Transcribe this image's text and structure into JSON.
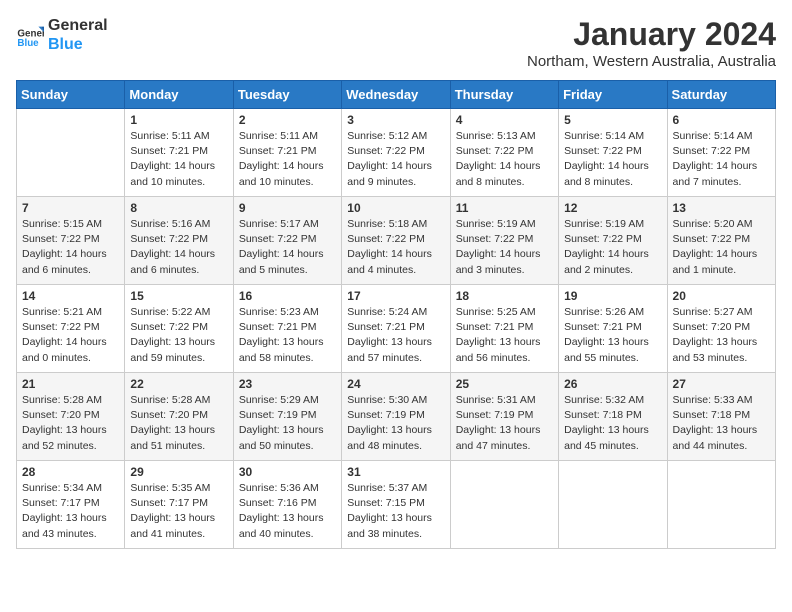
{
  "header": {
    "logo_line1": "General",
    "logo_line2": "Blue",
    "month_title": "January 2024",
    "location": "Northam, Western Australia, Australia"
  },
  "weekdays": [
    "Sunday",
    "Monday",
    "Tuesday",
    "Wednesday",
    "Thursday",
    "Friday",
    "Saturday"
  ],
  "weeks": [
    [
      {
        "day": "",
        "info": ""
      },
      {
        "day": "1",
        "info": "Sunrise: 5:11 AM\nSunset: 7:21 PM\nDaylight: 14 hours\nand 10 minutes."
      },
      {
        "day": "2",
        "info": "Sunrise: 5:11 AM\nSunset: 7:21 PM\nDaylight: 14 hours\nand 10 minutes."
      },
      {
        "day": "3",
        "info": "Sunrise: 5:12 AM\nSunset: 7:22 PM\nDaylight: 14 hours\nand 9 minutes."
      },
      {
        "day": "4",
        "info": "Sunrise: 5:13 AM\nSunset: 7:22 PM\nDaylight: 14 hours\nand 8 minutes."
      },
      {
        "day": "5",
        "info": "Sunrise: 5:14 AM\nSunset: 7:22 PM\nDaylight: 14 hours\nand 8 minutes."
      },
      {
        "day": "6",
        "info": "Sunrise: 5:14 AM\nSunset: 7:22 PM\nDaylight: 14 hours\nand 7 minutes."
      }
    ],
    [
      {
        "day": "7",
        "info": "Sunrise: 5:15 AM\nSunset: 7:22 PM\nDaylight: 14 hours\nand 6 minutes."
      },
      {
        "day": "8",
        "info": "Sunrise: 5:16 AM\nSunset: 7:22 PM\nDaylight: 14 hours\nand 6 minutes."
      },
      {
        "day": "9",
        "info": "Sunrise: 5:17 AM\nSunset: 7:22 PM\nDaylight: 14 hours\nand 5 minutes."
      },
      {
        "day": "10",
        "info": "Sunrise: 5:18 AM\nSunset: 7:22 PM\nDaylight: 14 hours\nand 4 minutes."
      },
      {
        "day": "11",
        "info": "Sunrise: 5:19 AM\nSunset: 7:22 PM\nDaylight: 14 hours\nand 3 minutes."
      },
      {
        "day": "12",
        "info": "Sunrise: 5:19 AM\nSunset: 7:22 PM\nDaylight: 14 hours\nand 2 minutes."
      },
      {
        "day": "13",
        "info": "Sunrise: 5:20 AM\nSunset: 7:22 PM\nDaylight: 14 hours\nand 1 minute."
      }
    ],
    [
      {
        "day": "14",
        "info": "Sunrise: 5:21 AM\nSunset: 7:22 PM\nDaylight: 14 hours\nand 0 minutes."
      },
      {
        "day": "15",
        "info": "Sunrise: 5:22 AM\nSunset: 7:22 PM\nDaylight: 13 hours\nand 59 minutes."
      },
      {
        "day": "16",
        "info": "Sunrise: 5:23 AM\nSunset: 7:21 PM\nDaylight: 13 hours\nand 58 minutes."
      },
      {
        "day": "17",
        "info": "Sunrise: 5:24 AM\nSunset: 7:21 PM\nDaylight: 13 hours\nand 57 minutes."
      },
      {
        "day": "18",
        "info": "Sunrise: 5:25 AM\nSunset: 7:21 PM\nDaylight: 13 hours\nand 56 minutes."
      },
      {
        "day": "19",
        "info": "Sunrise: 5:26 AM\nSunset: 7:21 PM\nDaylight: 13 hours\nand 55 minutes."
      },
      {
        "day": "20",
        "info": "Sunrise: 5:27 AM\nSunset: 7:20 PM\nDaylight: 13 hours\nand 53 minutes."
      }
    ],
    [
      {
        "day": "21",
        "info": "Sunrise: 5:28 AM\nSunset: 7:20 PM\nDaylight: 13 hours\nand 52 minutes."
      },
      {
        "day": "22",
        "info": "Sunrise: 5:28 AM\nSunset: 7:20 PM\nDaylight: 13 hours\nand 51 minutes."
      },
      {
        "day": "23",
        "info": "Sunrise: 5:29 AM\nSunset: 7:19 PM\nDaylight: 13 hours\nand 50 minutes."
      },
      {
        "day": "24",
        "info": "Sunrise: 5:30 AM\nSunset: 7:19 PM\nDaylight: 13 hours\nand 48 minutes."
      },
      {
        "day": "25",
        "info": "Sunrise: 5:31 AM\nSunset: 7:19 PM\nDaylight: 13 hours\nand 47 minutes."
      },
      {
        "day": "26",
        "info": "Sunrise: 5:32 AM\nSunset: 7:18 PM\nDaylight: 13 hours\nand 45 minutes."
      },
      {
        "day": "27",
        "info": "Sunrise: 5:33 AM\nSunset: 7:18 PM\nDaylight: 13 hours\nand 44 minutes."
      }
    ],
    [
      {
        "day": "28",
        "info": "Sunrise: 5:34 AM\nSunset: 7:17 PM\nDaylight: 13 hours\nand 43 minutes."
      },
      {
        "day": "29",
        "info": "Sunrise: 5:35 AM\nSunset: 7:17 PM\nDaylight: 13 hours\nand 41 minutes."
      },
      {
        "day": "30",
        "info": "Sunrise: 5:36 AM\nSunset: 7:16 PM\nDaylight: 13 hours\nand 40 minutes."
      },
      {
        "day": "31",
        "info": "Sunrise: 5:37 AM\nSunset: 7:15 PM\nDaylight: 13 hours\nand 38 minutes."
      },
      {
        "day": "",
        "info": ""
      },
      {
        "day": "",
        "info": ""
      },
      {
        "day": "",
        "info": ""
      }
    ]
  ]
}
